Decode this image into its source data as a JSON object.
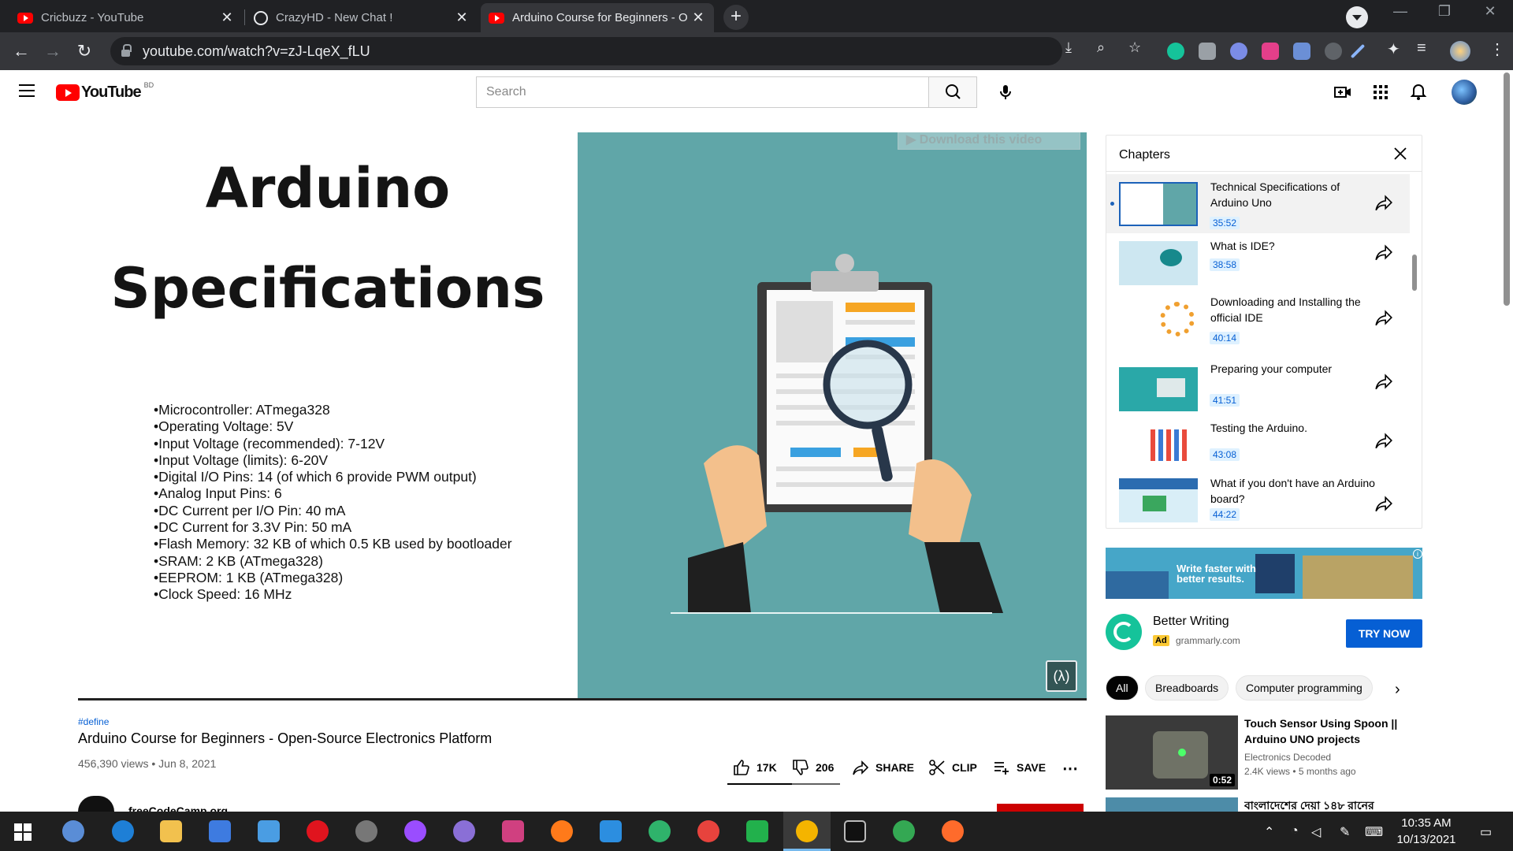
{
  "browser": {
    "tabs": [
      {
        "title": "Cricbuzz - YouTube",
        "icon": "youtube-favicon"
      },
      {
        "title": "CrazyHD - New Chat !",
        "icon": "globe-icon"
      },
      {
        "title": "Arduino Course for Beginners - O",
        "icon": "youtube-favicon"
      }
    ],
    "url": "youtube.com/watch?v=zJ-LqeX_fLU"
  },
  "youtube": {
    "logo_text": "YouTube",
    "region": "BD",
    "search_placeholder": "Search"
  },
  "video": {
    "slide_title_1": "Arduino",
    "slide_title_2": "Specifications",
    "specs": [
      "•Microcontroller: ATmega328",
      "•Operating Voltage: 5V",
      "•Input Voltage (recommended): 7-12V",
      "•Input Voltage (limits): 6-20V",
      "•Digital I/O Pins: 14 (of which 6 provide PWM output)",
      "•Analog Input Pins: 6",
      "•DC Current per I/O Pin: 40 mA",
      "•DC Current for 3.3V Pin: 50 mA",
      "•Flash Memory: 32 KB of which 0.5 KB used by bootloader",
      "•SRAM: 2 KB (ATmega328)",
      "•EEPROM: 1 KB (ATmega328)",
      "•Clock Speed: 16 MHz"
    ],
    "download_overlay": "▶ Download this video",
    "hashtag": "#define",
    "title": "Arduino Course for Beginners - Open-Source Electronics Platform",
    "meta": "456,390 views • Jun 8, 2021",
    "likes": "17K",
    "dislikes": "206",
    "share": "SHARE",
    "clip": "CLIP",
    "save": "SAVE",
    "more": "⋯",
    "channel_name": "freeCodeCamp.org"
  },
  "chapters": {
    "heading": "Chapters",
    "items": [
      {
        "title": "Technical Specifications of Arduino Uno",
        "time": "35:52",
        "active": true
      },
      {
        "title": "What is IDE?",
        "time": "38:58"
      },
      {
        "title": "Downloading and Installing the official IDE",
        "time": "40:14"
      },
      {
        "title": "Preparing your computer",
        "time": "41:51"
      },
      {
        "title": "Testing the Arduino.",
        "time": "43:08"
      },
      {
        "title": "What if you don't have an Arduino board?",
        "time": "44:22"
      }
    ]
  },
  "ad": {
    "banner_text_1": "Write faster with",
    "banner_text_2": "better results.",
    "title": "Better Writing",
    "badge": "Ad",
    "domain": "grammarly.com",
    "cta": "TRY NOW"
  },
  "chips": [
    "All",
    "Breadboards",
    "Computer programming"
  ],
  "recommendations": [
    {
      "title": "Touch Sensor Using Spoon || Arduino UNO projects",
      "channel": "Electronics Decoded",
      "meta": "2.4K views • 5 months ago",
      "duration": "0:52"
    },
    {
      "title": "বাংলাদেশের দেয়া ১৪৮ রানের"
    }
  ],
  "taskbar": {
    "time": "10:35 AM",
    "date": "10/13/2021"
  },
  "colors": {
    "youtube_red": "#ff0000",
    "link_blue": "#065fd4",
    "slide_teal": "#60a6a8",
    "chrome_dark": "#202124"
  }
}
